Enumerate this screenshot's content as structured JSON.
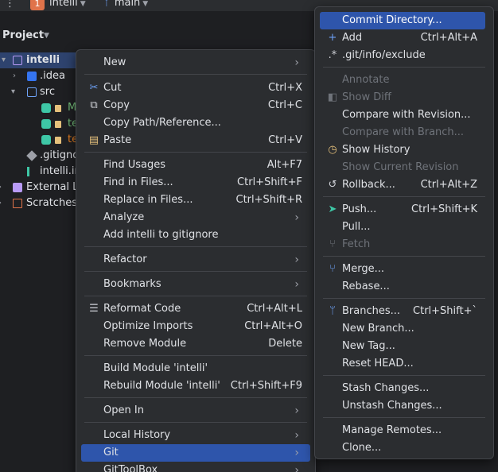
{
  "topbar": {
    "menu_glyph": "⋮",
    "project_badge": "1",
    "project": "intelli",
    "branch": "main"
  },
  "project_panel": {
    "title": "Project",
    "tree": {
      "root": "intelli",
      "idea": ".idea",
      "src": "src",
      "child1": "M",
      "child2": "te",
      "child3": "te",
      "gitignore": ".gitigno",
      "iml": "intelli.in",
      "external": "External Li",
      "scratches": "Scratches"
    }
  },
  "context_menu": {
    "items": [
      {
        "label": "New",
        "shortcut": "",
        "submenu": true
      },
      {
        "label": "Cut",
        "shortcut": "Ctrl+X",
        "icon": "scissors-icon"
      },
      {
        "label": "Copy",
        "shortcut": "Ctrl+C",
        "icon": "copy-icon"
      },
      {
        "label": "Copy Path/Reference...",
        "shortcut": ""
      },
      {
        "label": "Paste",
        "shortcut": "Ctrl+V",
        "icon": "clipboard-icon"
      },
      {
        "label": "Find Usages",
        "shortcut": "Alt+F7"
      },
      {
        "label": "Find in Files...",
        "shortcut": "Ctrl+Shift+F"
      },
      {
        "label": "Replace in Files...",
        "shortcut": "Ctrl+Shift+R"
      },
      {
        "label": "Analyze",
        "shortcut": "",
        "submenu": true
      },
      {
        "label": "Add intelli to gitignore",
        "shortcut": ""
      },
      {
        "label": "Refactor",
        "shortcut": "",
        "submenu": true
      },
      {
        "label": "Bookmarks",
        "shortcut": "",
        "submenu": true
      },
      {
        "label": "Reformat Code",
        "shortcut": "Ctrl+Alt+L",
        "icon": "reformat-icon"
      },
      {
        "label": "Optimize Imports",
        "shortcut": "Ctrl+Alt+O"
      },
      {
        "label": "Remove Module",
        "shortcut": "Delete"
      },
      {
        "label": "Build Module 'intelli'",
        "shortcut": ""
      },
      {
        "label": "Rebuild Module 'intelli'",
        "shortcut": "Ctrl+Shift+F9"
      },
      {
        "label": "Open In",
        "shortcut": "",
        "submenu": true
      },
      {
        "label": "Local History",
        "shortcut": "",
        "submenu": true
      },
      {
        "label": "Git",
        "shortcut": "",
        "submenu": true
      },
      {
        "label": "GitToolBox",
        "shortcut": "",
        "submenu": true
      }
    ]
  },
  "git_menu": {
    "items": [
      {
        "label": "Commit Directory...",
        "shortcut": ""
      },
      {
        "label": "Add",
        "shortcut": "Ctrl+Alt+A",
        "icon": "plus-icon"
      },
      {
        "label": ".git/info/exclude",
        "shortcut": "",
        "icon": "regex-icon"
      },
      {
        "label": "Annotate",
        "shortcut": "",
        "disabled": true
      },
      {
        "label": "Show Diff",
        "shortcut": "",
        "disabled": true,
        "icon": "diff-icon"
      },
      {
        "label": "Compare with Revision...",
        "shortcut": ""
      },
      {
        "label": "Compare with Branch...",
        "shortcut": "",
        "disabled": true
      },
      {
        "label": "Show History",
        "shortcut": "",
        "icon": "history-icon"
      },
      {
        "label": "Show Current Revision",
        "shortcut": "",
        "disabled": true
      },
      {
        "label": "Rollback...",
        "shortcut": "Ctrl+Alt+Z",
        "icon": "rollback-icon"
      },
      {
        "label": "Push...",
        "shortcut": "Ctrl+Shift+K",
        "icon": "push-icon"
      },
      {
        "label": "Pull...",
        "shortcut": ""
      },
      {
        "label": "Fetch",
        "shortcut": "",
        "disabled": true,
        "icon": "fetch-icon"
      },
      {
        "label": "Merge...",
        "shortcut": "",
        "icon": "merge-icon"
      },
      {
        "label": "Rebase...",
        "shortcut": ""
      },
      {
        "label": "Branches...",
        "shortcut": "Ctrl+Shift+`",
        "icon": "branch-icon"
      },
      {
        "label": "New Branch...",
        "shortcut": ""
      },
      {
        "label": "New Tag...",
        "shortcut": ""
      },
      {
        "label": "Reset HEAD...",
        "shortcut": ""
      },
      {
        "label": "Stash Changes...",
        "shortcut": ""
      },
      {
        "label": "Unstash Changes...",
        "shortcut": ""
      },
      {
        "label": "Manage Remotes...",
        "shortcut": ""
      },
      {
        "label": "Clone...",
        "shortcut": ""
      }
    ]
  },
  "colors": {
    "highlight": "#2e55ab",
    "background": "#2b2d30",
    "accent_green": "#3ec7a6"
  }
}
